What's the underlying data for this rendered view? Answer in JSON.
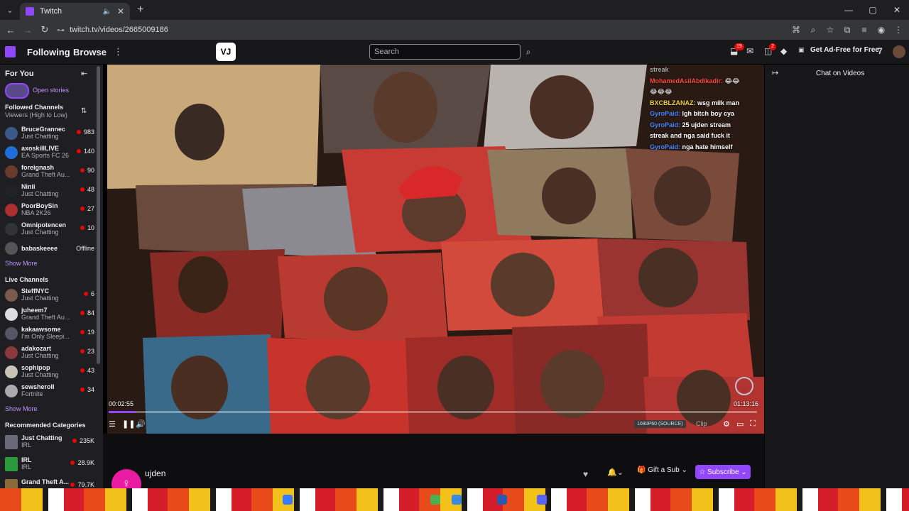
{
  "browser": {
    "tab_title": "Twitch",
    "url": "twitch.tv/videos/2665009186",
    "new_tab_glyph": "+",
    "tab_close_glyph": "✕",
    "window_controls": [
      "—",
      "▢",
      "✕"
    ]
  },
  "topnav": {
    "following": "Following",
    "browse": "Browse",
    "more": "⋮",
    "extension_label": "VJ",
    "search_placeholder": "Search",
    "notif_badge_1": "19",
    "notif_badge_2": "2",
    "adfree": "Get Ad-Free for Free"
  },
  "sidebar": {
    "for_you": "For You",
    "open_stories": "Open stories",
    "followed_title": "Followed Channels",
    "followed_sub": "Viewers (High to Low)",
    "followed": [
      {
        "name": "BruceGrannec",
        "game": "Just Chatting",
        "viewers": "983",
        "color": "#3b5a8a"
      },
      {
        "name": "axoskillLIVE",
        "game": "EA Sports FC 26",
        "viewers": "140",
        "color": "#1e6fd9"
      },
      {
        "name": "foreignash",
        "game": "Grand Theft Au...",
        "viewers": "90",
        "color": "#6a3a2a"
      },
      {
        "name": "Ninii",
        "game": "Just Chatting",
        "viewers": "48",
        "color": "#222"
      },
      {
        "name": "PoorBoySin",
        "game": "NBA 2K26",
        "viewers": "27",
        "color": "#b03030"
      },
      {
        "name": "Omnipotencen",
        "game": "Just Chatting",
        "viewers": "10",
        "color": "#333"
      },
      {
        "name": "babaskeeee",
        "game": "",
        "viewers": "Offline",
        "color": "#555"
      }
    ],
    "show_more": "Show More",
    "live_title": "Live Channels",
    "live": [
      {
        "name": "SteffNYC",
        "game": "Just Chatting",
        "viewers": "6",
        "color": "#7a5a4a"
      },
      {
        "name": "juheem7",
        "game": "Grand Theft Au...",
        "viewers": "84",
        "color": "#ddd"
      },
      {
        "name": "kakaawsome",
        "game": "I'm Only Sleepi...",
        "viewers": "19",
        "color": "#556"
      },
      {
        "name": "adakozart",
        "game": "Just Chatting",
        "viewers": "23",
        "color": "#8a3a3a"
      },
      {
        "name": "sophipop",
        "game": "Just Chatting",
        "viewers": "43",
        "color": "#c9c3b8"
      },
      {
        "name": "sewsheroII",
        "game": "Fortnite",
        "viewers": "34",
        "color": "#aaa"
      }
    ],
    "show_more_2": "Show More",
    "rec_title": "Recommended Categories",
    "categories": [
      {
        "name": "Just Chatting",
        "tag": "IRL",
        "viewers": "235K",
        "color": "#6a6a7a"
      },
      {
        "name": "IRL",
        "tag": "IRL",
        "viewers": "28.9K",
        "color": "#2a9a3a"
      },
      {
        "name": "Grand Theft A...",
        "tag": "",
        "viewers": "79.7K",
        "color": "#8a6a3a"
      }
    ]
  },
  "player": {
    "chat_lines": [
      {
        "user": "",
        "text": "streak",
        "cls": ""
      },
      {
        "user": "MohamedAsilAbdikadir:",
        "text": "😂😂",
        "cls": "r"
      },
      {
        "user": "",
        "text": "😂😂😂",
        "cls": ""
      },
      {
        "user": "BXCBLZANAZ:",
        "text": "wsg milk man",
        "cls": "y"
      },
      {
        "user": "GyroPaid:",
        "text": "lgh bitch boy cya",
        "cls": "u"
      },
      {
        "user": "GyroPaid:",
        "text": "25 ujden stream",
        "cls": "u"
      },
      {
        "user": "",
        "text": "streak and nga said fuck it",
        "cls": ""
      },
      {
        "user": "GyroPaid:",
        "text": "nga hate himself",
        "cls": "u"
      }
    ],
    "time_current": "00:02:55",
    "time_total": "01:13:16",
    "progress": 0.04,
    "quality": "1080P60 (SOURCE)",
    "clip": "Clip"
  },
  "chat": {
    "header": "Chat on Videos"
  },
  "below": {
    "streamer": "ujden",
    "gift": "Gift a Sub",
    "subscribe": "Subscribe"
  },
  "colors": {
    "accent": "#9146ff",
    "live": "#eb0400"
  }
}
